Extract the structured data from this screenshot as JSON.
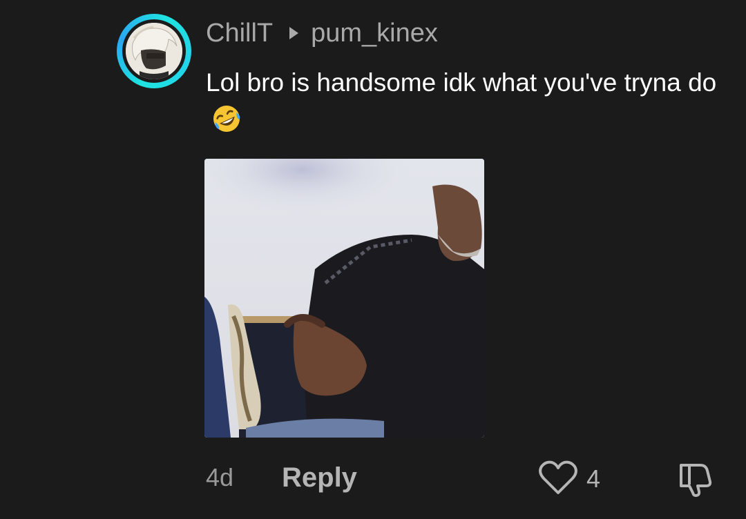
{
  "comment": {
    "author": "ChillT",
    "reply_to": "pum_kinex",
    "text": "Lol bro is handsome idk what you've tryna do",
    "emoji": "rolling-on-the-floor-laughing"
  },
  "footer": {
    "time": "4d",
    "reply_label": "Reply",
    "like_count": "4"
  },
  "colors": {
    "background": "#1b1b1b",
    "ring_accent": "#1fe3e0",
    "muted_text": "#a9a9a9",
    "primary_text": "#ffffff"
  }
}
